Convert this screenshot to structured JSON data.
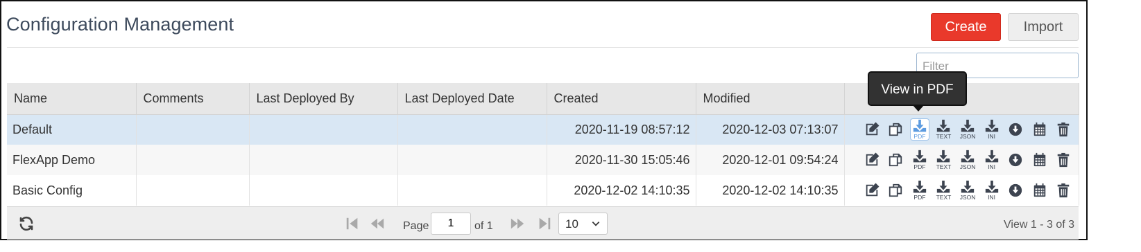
{
  "page": {
    "title": "Configuration Management",
    "create_label": "Create",
    "import_label": "Import",
    "filter_placeholder": "Filter"
  },
  "table": {
    "columns": [
      "Name",
      "Comments",
      "Last Deployed By",
      "Last Deployed Date",
      "Created",
      "Modified",
      ""
    ],
    "rows": [
      {
        "name": "Default",
        "comments": "",
        "deployed_by": "",
        "deployed_date": "",
        "created": "2020-11-19 08:57:12",
        "modified": "2020-12-03 07:13:07",
        "selected": true
      },
      {
        "name": "FlexApp Demo",
        "comments": "",
        "deployed_by": "",
        "deployed_date": "",
        "created": "2020-11-30 15:05:46",
        "modified": "2020-12-01 09:54:24",
        "selected": false
      },
      {
        "name": "Basic Config",
        "comments": "",
        "deployed_by": "",
        "deployed_date": "",
        "created": "2020-12-02 14:10:35",
        "modified": "2020-12-02 14:10:35",
        "selected": false
      }
    ],
    "actions": [
      {
        "icon": "edit-icon",
        "label": ""
      },
      {
        "icon": "copy-icon",
        "label": ""
      },
      {
        "icon": "download-pdf-icon",
        "label": "PDF"
      },
      {
        "icon": "download-text-icon",
        "label": "TEXT"
      },
      {
        "icon": "download-json-icon",
        "label": "JSON"
      },
      {
        "icon": "download-ini-icon",
        "label": "INI"
      },
      {
        "icon": "deploy-icon",
        "label": ""
      },
      {
        "icon": "calendar-icon",
        "label": ""
      },
      {
        "icon": "trash-icon",
        "label": ""
      }
    ]
  },
  "tooltip": {
    "text": "View in PDF"
  },
  "pager": {
    "page_label": "Page",
    "page_value": "1",
    "of_label": "of 1",
    "page_size": "10",
    "range_text": "View 1 - 3 of 3"
  },
  "colors": {
    "accent_create": "#e9392b",
    "selected_row": "#d9e7f4",
    "header_bg": "#e7e7e7",
    "active_icon": "#5c9be0"
  }
}
